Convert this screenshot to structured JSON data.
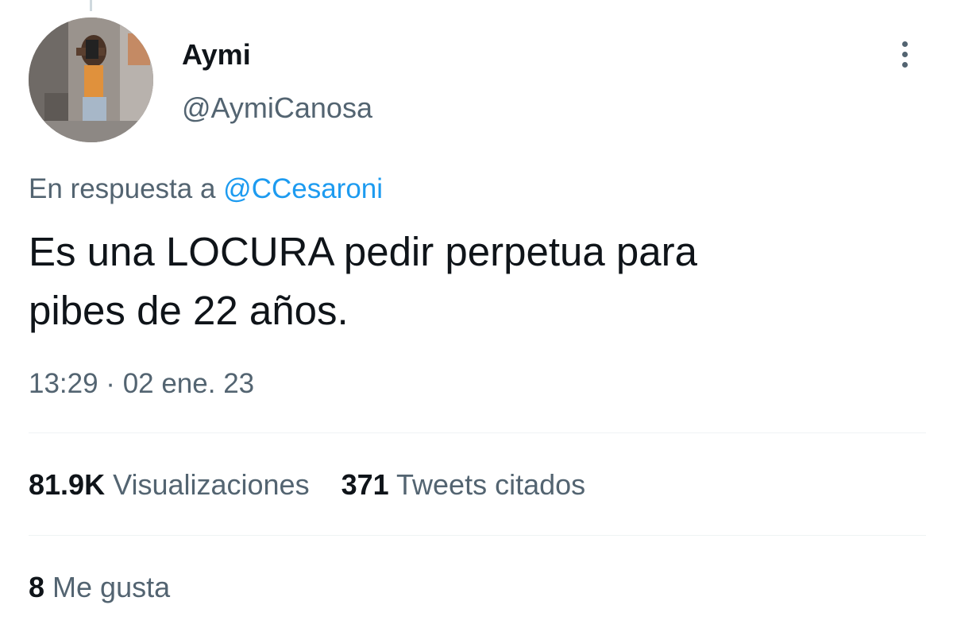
{
  "author": {
    "name": "Aymi",
    "handle": "@AymiCanosa"
  },
  "icons": {
    "more": "more-vertical-icon",
    "avatar": "profile-photo"
  },
  "reply": {
    "prefix": "En respuesta a",
    "mention": "@CCesaroni"
  },
  "tweet": {
    "text_line1": "Es una LOCURA pedir perpetua para",
    "text_line2": "pibes de 22 años.",
    "timestamp": "13:29 · 02 ene. 23"
  },
  "stats": {
    "views_count": "81.9K",
    "views_label": "Visualizaciones",
    "quotes_count": "371",
    "quotes_label": "Tweets citados",
    "likes_count": "8",
    "likes_label": "Me gusta"
  },
  "colors": {
    "text_primary": "#0f1419",
    "text_secondary": "#536471",
    "link": "#1d9bf0",
    "divider": "#eff3f4"
  }
}
